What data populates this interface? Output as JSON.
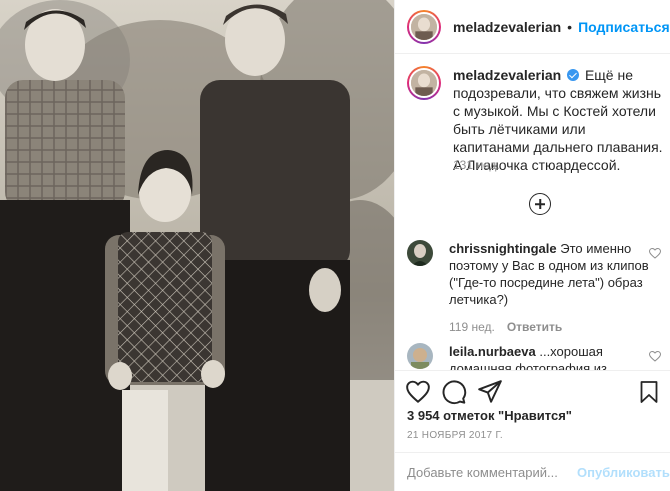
{
  "header": {
    "username": "meladzevalerian",
    "separator": "•",
    "follow_label": "Подписаться"
  },
  "caption": {
    "username": "meladzevalerian",
    "text": "Ещё не подозревали, что свяжем жизнь с музыкой. Мы с Костей хотели быть лётчиками или капитанами дальнего плавания. А Лианочка стюардессой.",
    "time": "131 нед.",
    "verified": true
  },
  "comments": [
    {
      "username": "chrissnightingale",
      "text": "Это именно поэтому у Вас в одном из клипов (\"Где-то посредине лета\") образ летчика?)",
      "time": "119 нед.",
      "reply_label": "Ответить"
    },
    {
      "username": "leila.nurbaeva",
      "text": "...хорошая домашняя фотография из"
    }
  ],
  "actions": {
    "likes": "3 954 отметок \"Нравится\"",
    "date": "21 НОЯБРЯ 2017 Г.",
    "comment_placeholder": "Добавьте комментарий...",
    "publish_label": "Опубликовать"
  },
  "icons": {
    "like": "heart-icon",
    "comment": "comment-icon",
    "share": "share-icon",
    "save": "bookmark-icon",
    "load_more": "plus-circle-icon"
  },
  "colors": {
    "link": "#0095f6",
    "publish_disabled": "#b2dffc",
    "muted": "#8e8e8e",
    "verified": "#3897f0"
  }
}
